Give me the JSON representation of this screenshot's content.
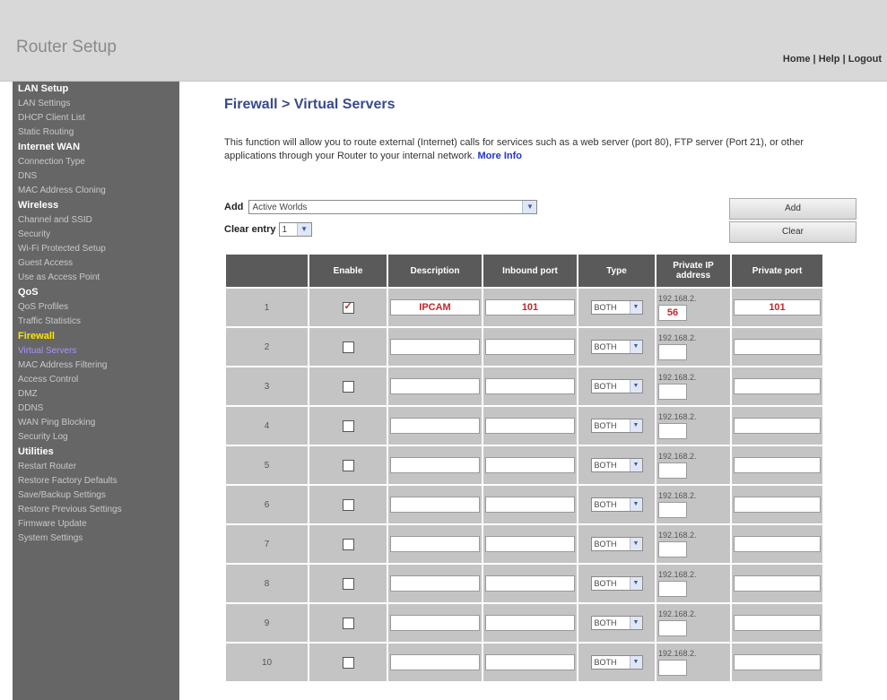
{
  "header": {
    "brand": "Router Setup",
    "links": [
      "Home",
      "Help",
      "Logout"
    ],
    "link_separator": "|"
  },
  "sidebar": [
    {
      "type": "header",
      "label": "LAN Setup"
    },
    {
      "type": "item",
      "label": "LAN Settings"
    },
    {
      "type": "item",
      "label": "DHCP Client List"
    },
    {
      "type": "item",
      "label": "Static Routing"
    },
    {
      "type": "header",
      "label": "Internet WAN"
    },
    {
      "type": "item",
      "label": "Connection Type"
    },
    {
      "type": "item",
      "label": "DNS"
    },
    {
      "type": "item",
      "label": "MAC Address Cloning"
    },
    {
      "type": "header",
      "label": "Wireless"
    },
    {
      "type": "item",
      "label": "Channel and SSID"
    },
    {
      "type": "item",
      "label": "Security"
    },
    {
      "type": "item",
      "label": "Wi-Fi Protected Setup"
    },
    {
      "type": "item",
      "label": "Guest Access"
    },
    {
      "type": "item",
      "label": "Use as Access Point"
    },
    {
      "type": "header",
      "label": "QoS"
    },
    {
      "type": "item",
      "label": "QoS Profiles"
    },
    {
      "type": "item",
      "label": "Traffic Statistics"
    },
    {
      "type": "header",
      "label": "Firewall",
      "active": true
    },
    {
      "type": "item",
      "label": "Virtual Servers",
      "current": true
    },
    {
      "type": "item",
      "label": "MAC Address Filtering"
    },
    {
      "type": "item",
      "label": "Access Control"
    },
    {
      "type": "item",
      "label": "DMZ"
    },
    {
      "type": "item",
      "label": "DDNS"
    },
    {
      "type": "item",
      "label": "WAN Ping Blocking"
    },
    {
      "type": "item",
      "label": "Security Log"
    },
    {
      "type": "header",
      "label": "Utilities"
    },
    {
      "type": "item",
      "label": "Restart Router"
    },
    {
      "type": "item",
      "label": "Restore Factory Defaults"
    },
    {
      "type": "item",
      "label": "Save/Backup Settings"
    },
    {
      "type": "item",
      "label": "Restore Previous Settings"
    },
    {
      "type": "item",
      "label": "Firmware Update"
    },
    {
      "type": "item",
      "label": "System Settings"
    }
  ],
  "main": {
    "title_section": "Firewall",
    "title_sep": ">",
    "title_page": "Virtual Servers",
    "description": "This function will allow you to route external (Internet) calls for services such as a web server (port 80), FTP server (Port 21), or other applications through your Router to your internal network.",
    "more_info": "More Info",
    "add_label": "Add",
    "add_selected": "Active Worlds",
    "clear_label": "Clear entry",
    "clear_selected": "1",
    "add_button": "Add",
    "clear_button": "Clear"
  },
  "table": {
    "columns": [
      "",
      "Enable",
      "Description",
      "Inbound port",
      "Type",
      "Private IP address",
      "Private port"
    ],
    "ip_prefix": "192.168.2.",
    "rows": [
      {
        "num": "1",
        "enabled": true,
        "description": "IPCAM",
        "inbound": "101",
        "type": "BOTH",
        "ip": "56",
        "private_port": "101"
      },
      {
        "num": "2",
        "enabled": false,
        "description": "",
        "inbound": "",
        "type": "BOTH",
        "ip": "",
        "private_port": ""
      },
      {
        "num": "3",
        "enabled": false,
        "description": "",
        "inbound": "",
        "type": "BOTH",
        "ip": "",
        "private_port": ""
      },
      {
        "num": "4",
        "enabled": false,
        "description": "",
        "inbound": "",
        "type": "BOTH",
        "ip": "",
        "private_port": ""
      },
      {
        "num": "5",
        "enabled": false,
        "description": "",
        "inbound": "",
        "type": "BOTH",
        "ip": "",
        "private_port": ""
      },
      {
        "num": "6",
        "enabled": false,
        "description": "",
        "inbound": "",
        "type": "BOTH",
        "ip": "",
        "private_port": ""
      },
      {
        "num": "7",
        "enabled": false,
        "description": "",
        "inbound": "",
        "type": "BOTH",
        "ip": "",
        "private_port": ""
      },
      {
        "num": "8",
        "enabled": false,
        "description": "",
        "inbound": "",
        "type": "BOTH",
        "ip": "",
        "private_port": ""
      },
      {
        "num": "9",
        "enabled": false,
        "description": "",
        "inbound": "",
        "type": "BOTH",
        "ip": "",
        "private_port": ""
      },
      {
        "num": "10",
        "enabled": false,
        "description": "",
        "inbound": "",
        "type": "BOTH",
        "ip": "",
        "private_port": ""
      }
    ]
  },
  "colors": {
    "sidebar_bg": "#666666",
    "header_bg": "#d8d8d8",
    "active_section": "#ffe400",
    "current_item": "#a995ff",
    "title": "#3a4a8a",
    "value_red": "#c0282d"
  }
}
